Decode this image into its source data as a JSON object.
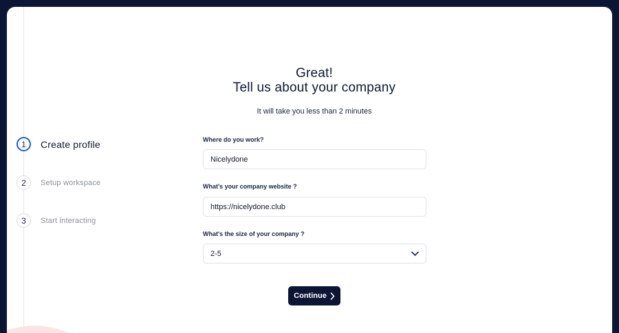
{
  "steps": [
    {
      "number": "1",
      "label": "Create profile",
      "state": "active"
    },
    {
      "number": "2",
      "label": "Setup workspace",
      "state": "pending"
    },
    {
      "number": "3",
      "label": "Start interacting",
      "state": "pending"
    }
  ],
  "header": {
    "line1": "Great!",
    "line2": "Tell us about your company",
    "subtitle": "It will take you less than 2 minutes"
  },
  "form": {
    "company": {
      "label": "Where do you work?",
      "value": "Nicelydone"
    },
    "website": {
      "label": "What's your company website ?",
      "value": "https://nicelydone.club"
    },
    "size": {
      "label": "What's the size of your company ?",
      "value": "2-5"
    }
  },
  "actions": {
    "continue_label": "Continue"
  },
  "colors": {
    "brand_dark": "#0c1634",
    "active_step": "#1d5fc4",
    "deco_pink": "#fde3e3",
    "deco_blue": "#eaf2fd"
  }
}
